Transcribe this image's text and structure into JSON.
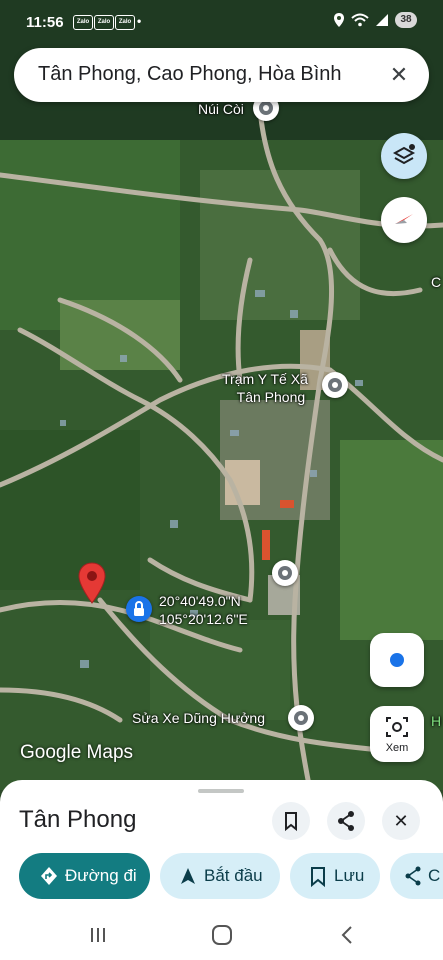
{
  "status": {
    "time": "11:56",
    "notif_icons": [
      "Zalo",
      "Zalo",
      "Zalo"
    ],
    "battery": "38"
  },
  "search": {
    "query": "Tân Phong, Cao Phong, Hòa Bình"
  },
  "map": {
    "labels": {
      "nui_coi": "Núi Còi",
      "tram_line1": "Trạm Y Tế Xã",
      "tram_line2": "Tân Phong",
      "coord_lat": "20°40'49.0\"N",
      "coord_lng": "105°20'12.6\"E",
      "sua_xe": "Sửa Xe Dũng Hưởng",
      "edge_c": "C",
      "edge_h": "H"
    },
    "xem_label": "Xem",
    "logo": "Google Maps"
  },
  "sheet": {
    "place_name": "Tân Phong",
    "chips": [
      {
        "icon": "directions-icon",
        "label": "Đường đi"
      },
      {
        "icon": "navigation-arrow-icon",
        "label": "Bắt đầu"
      },
      {
        "icon": "bookmark-icon",
        "label": "Lưu"
      },
      {
        "icon": "share-icon",
        "label": "C"
      }
    ]
  },
  "colors": {
    "primary_chip": "#137c81",
    "chip": "#d6eef7",
    "pin": "#e53935"
  }
}
